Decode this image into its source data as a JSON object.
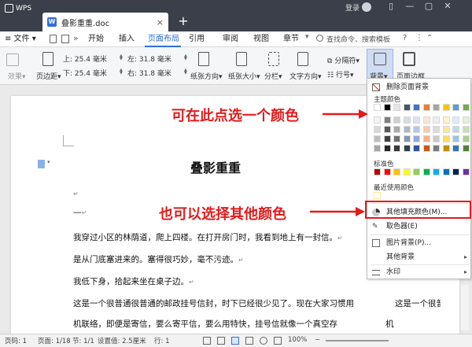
{
  "titlebar": {
    "app_name": "WPS",
    "tab_label": "叠影重重.doc",
    "tab_close": "×",
    "new_tab": "+",
    "login": "登录",
    "win_buttons": [
      "▯",
      "—",
      "▢",
      "✕"
    ]
  },
  "menubar": {
    "menu_label": "≡ 文件 ▾",
    "items": [
      "开始",
      "插入",
      "页面布局",
      "引用",
      "审阅",
      "视图",
      "章节"
    ],
    "active_index": 2,
    "search_placeholder": "查找命令、搜索模板",
    "accent_color": "#2f6fdc"
  },
  "ribbon": {
    "effects": "效果▾",
    "margins": "页边距▾",
    "top_label": "上:",
    "top_value": "25.4 毫米",
    "bottom_label": "下:",
    "bottom_value": "25.4 毫米",
    "left_label": "左:",
    "left_value": "31.8 毫米",
    "right_label": "右:",
    "right_value": "31.8 毫米",
    "orientation": "纸张方向▾",
    "size": "纸张大小▾",
    "columns": "分栏▾",
    "text_direction": "文字方向▾",
    "section_break": "分隔符▾",
    "line_numbers": "行号▾",
    "background": "背景▾",
    "page_border": "页面边框"
  },
  "document": {
    "title": "叠影重重",
    "dash": "—",
    "paragraphs": [
      "我穿过小区的林荫道，爬上四楼。在打开房门时，我看到地上有一封信。",
      "是从门底塞进来的。塞得很巧妙，毫不污迹。",
      "我低下身，拾起来坐在桌子边。",
      "这是一个很普通很普通的邮政挂号信封，时下已经很少见了。现在大家习惯用",
      "机联络，即便是寄信，要么寄平信，要么用特快，挂号信就像一个真空存"
    ],
    "right_cut": [
      "这是一个很普",
      "机"
    ],
    "para_mark": "↵"
  },
  "dropdown": {
    "delete_bg": "删除页面背景",
    "theme_colors_label": "主题颜色",
    "standard_colors_label": "标准色",
    "recent_colors_label": "最近使用颜色",
    "more_fill": "其他填充颜色(M)...",
    "eyedropper": "取色器(E)",
    "picture_bg": "图片背景(P)...",
    "other_bg": "其他背景",
    "watermark": "水印",
    "theme_colors": [
      [
        "#ffffff",
        "#000000",
        "#e7e6e6",
        "#44546a",
        "#4472c4",
        "#ed7d31",
        "#a5a5a5",
        "#ffc000",
        "#5b9bd5",
        "#70ad47"
      ],
      [
        "#f2f2f2",
        "#7f7f7f",
        "#d0cece",
        "#d6dce5",
        "#dae3f3",
        "#fbe5d6",
        "#ededed",
        "#fff2cc",
        "#deebf7",
        "#e2f0d9"
      ],
      [
        "#d9d9d9",
        "#595959",
        "#aeabab",
        "#adb9ca",
        "#b4c7e7",
        "#f8cbad",
        "#dbdbdb",
        "#ffe699",
        "#bdd7ee",
        "#c5e0b4"
      ],
      [
        "#bfbfbf",
        "#404040",
        "#757171",
        "#8497b0",
        "#8faadc",
        "#f4b183",
        "#c9c9c9",
        "#ffd966",
        "#9dc3e6",
        "#a9d18e"
      ],
      [
        "#a6a6a6",
        "#262626",
        "#3b3838",
        "#323f4f",
        "#2f5597",
        "#c55a11",
        "#7b7b7b",
        "#bf9000",
        "#2e75b6",
        "#538135"
      ]
    ],
    "standard_colors": [
      "#c00000",
      "#ff0000",
      "#ffc000",
      "#ffff00",
      "#92d050",
      "#00b050",
      "#00b0f0",
      "#0070c0",
      "#002060",
      "#7030a0"
    ],
    "recent_colors": [
      "#ffe699"
    ],
    "submenu_arrow": "▸"
  },
  "annotations": {
    "top": "可在此点选一个颜色",
    "bottom": "也可以选择其他颜色",
    "color": "#e21b1b"
  },
  "statusbar": {
    "page_num": "页码: 1",
    "page": "页面: 1/18",
    "section": "节: 1/1",
    "setting": "设置值: 2.5厘米",
    "row": "行: 1",
    "zoom": "100%",
    "zoom_minus": "−"
  }
}
